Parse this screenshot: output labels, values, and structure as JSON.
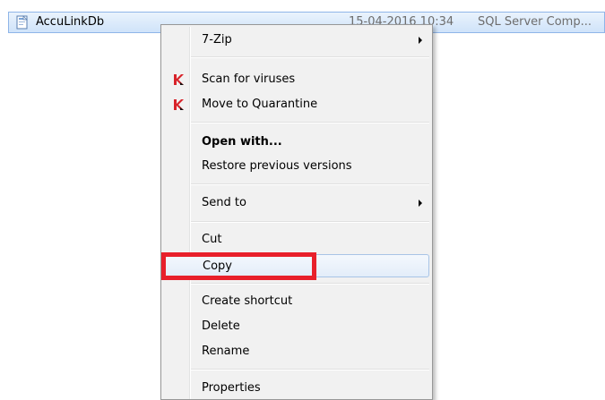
{
  "file": {
    "name": "AccuLinkDb",
    "date": "15-04-2016 10:34",
    "type": "SQL Server Comp..."
  },
  "menu": {
    "items": [
      {
        "label": "7-Zip",
        "icon": null,
        "submenu": true
      },
      {
        "label": "Scan for viruses",
        "icon": "kaspersky-icon",
        "submenu": false
      },
      {
        "label": "Move to Quarantine",
        "icon": "kaspersky-icon",
        "submenu": false
      },
      {
        "label": "Open with...",
        "icon": null,
        "submenu": false,
        "bold": true
      },
      {
        "label": "Restore previous versions",
        "icon": null,
        "submenu": false
      },
      {
        "label": "Send to",
        "icon": null,
        "submenu": true
      },
      {
        "label": "Cut",
        "icon": null,
        "submenu": false
      },
      {
        "label": "Copy",
        "icon": null,
        "submenu": false,
        "highlighted": true
      },
      {
        "label": "Create shortcut",
        "icon": null,
        "submenu": false
      },
      {
        "label": "Delete",
        "icon": null,
        "submenu": false
      },
      {
        "label": "Rename",
        "icon": null,
        "submenu": false
      },
      {
        "label": "Properties",
        "icon": null,
        "submenu": false
      }
    ]
  },
  "annotation": {
    "highlight_color": "#e8202b",
    "target": "Copy"
  },
  "colors": {
    "selection": "#cfe3fa",
    "menu_bg": "#f1f1f1",
    "kaspersky_red": "#d8232a"
  }
}
